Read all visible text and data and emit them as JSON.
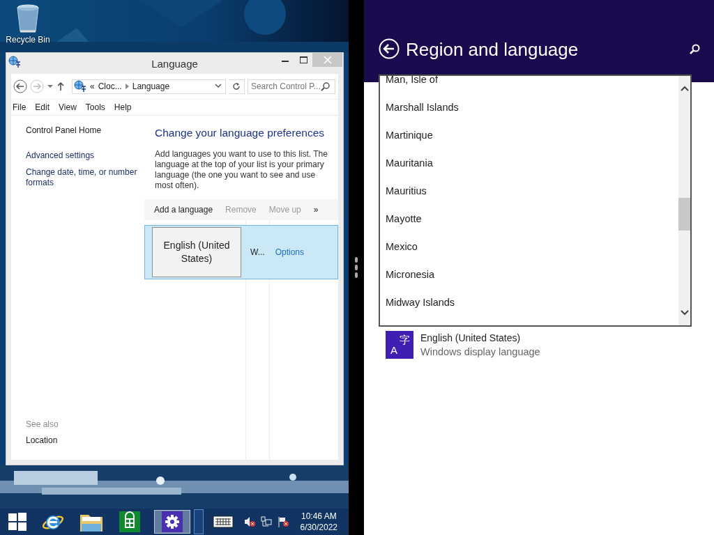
{
  "desktop": {
    "icons": [
      {
        "label": "Recycle Bin"
      }
    ]
  },
  "window": {
    "title": "Language",
    "address": {
      "prefix": "«",
      "crumbs": [
        "Cloc...",
        "Language"
      ]
    },
    "search": {
      "placeholder": "Search Control P..."
    },
    "menu": [
      "File",
      "Edit",
      "View",
      "Tools",
      "Help"
    ],
    "sidebar": {
      "links": [
        "Control Panel Home",
        "Advanced settings",
        "Change date, time, or number formats"
      ],
      "see_also": {
        "heading": "See also",
        "links": [
          "Location"
        ]
      }
    },
    "heading": "Change your language preferences",
    "description": "Add languages you want to use to this list. The language at the top of your list is your primary language (the one you want to see and use most often).",
    "toolbar": [
      {
        "label": "Add a language",
        "disabled": false
      },
      {
        "label": "Remove",
        "disabled": true
      },
      {
        "label": "Move up",
        "disabled": true
      }
    ],
    "toolbar_more": "»",
    "languages": [
      {
        "name": "English (United States)",
        "column_2": "W...",
        "options": "Options",
        "selected": true
      }
    ]
  },
  "taskbar": {
    "apps": [
      {
        "kind": "browser",
        "selected": false
      },
      {
        "kind": "folder",
        "selected": false
      },
      {
        "kind": "store",
        "selected": false
      },
      {
        "kind": "settings",
        "selected": true
      }
    ],
    "time": "10:46 AM",
    "date": "6/30/2022"
  },
  "settings": {
    "title": "Region and language",
    "countries": [
      {
        "name": "Man, Isle of",
        "selected": false
      },
      {
        "name": "Marshall Islands",
        "selected": false
      },
      {
        "name": "Martinique",
        "selected": false
      },
      {
        "name": "Mauritania",
        "selected": false
      },
      {
        "name": "Mauritius",
        "selected": false
      },
      {
        "name": "Mayotte",
        "selected": false
      },
      {
        "name": "Mexico",
        "selected": false
      },
      {
        "name": "Micronesia",
        "selected": false
      },
      {
        "name": "Midway Islands",
        "selected": false
      }
    ],
    "display_language": {
      "icon_latin": "A",
      "icon_cjk": "字",
      "name": "English (United States)",
      "subtitle": "Windows display language"
    }
  }
}
